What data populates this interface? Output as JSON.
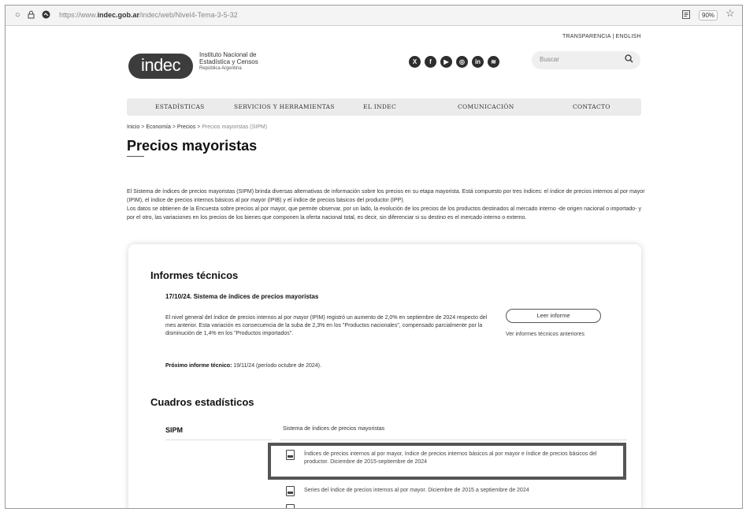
{
  "browser": {
    "url_prefix": "https://www.",
    "url_domain": "indec.gob.ar",
    "url_path": "/indec/web/Nivel4-Tema-3-5-32",
    "zoom": "90%"
  },
  "header": {
    "top_links": "TRANSPARENCIA | ENGLISH",
    "logo_text": "indec",
    "org_line1": "Instituto Nacional de",
    "org_line2": "Estadística y Censos",
    "org_line3": "República Argentina",
    "social_icons": [
      "x-icon",
      "facebook-icon",
      "youtube-icon",
      "instagram-icon",
      "linkedin-icon",
      "spotify-icon"
    ],
    "search_placeholder": "Buscar"
  },
  "nav": {
    "items": [
      "ESTADÍSTICAS",
      "SERVICIOS Y HERRAMIENTAS",
      "EL INDEC",
      "COMUNICACIÓN",
      "CONTACTO"
    ]
  },
  "breadcrumb": {
    "items": [
      "Inicio",
      "Economía",
      "Precios",
      "Precios mayoristas (SIPM)"
    ],
    "separator": ">"
  },
  "page": {
    "title": "Precios mayoristas",
    "intro_p1": "El Sistema de índices de precios mayoristas (SIPM) brinda diversas alternativas de información sobre los precios en su etapa mayorista. Está compuesto por tres índices: el índice de precios internos al por mayor (IPIM), el índice de precios internos básicos al por mayor (IPIB) y el índice de precios básicos del productor (IPP).",
    "intro_p2": "Los datos se obtienen de la Encuesta sobre precios al por mayor, que permite observar, por un lado, la evolución de los precios de los productos destinados al mercado interno -de origen nacional o importado- y por el otro, las variaciones en los precios de los bienes que componen la oferta nacional total, es decir, sin diferenciar si su destino es el mercado interno o externo."
  },
  "informes": {
    "heading": "Informes técnicos",
    "report_title": "17/10/24. Sistema de índices de precios mayoristas",
    "report_text": "El nivel general del índice de precios internos al por mayor (IPIM) registró un aumento de 2,0% en septiembre de 2024 respecto del mes anterior. Esta variación es consecuencia de la suba de 2,3% en los \"Productos nacionales\", compensado parcialmente por la disminución de 1,4% en los \"Productos importados\".",
    "next_label": "Próximo informe técnico:",
    "next_value": "19/11/24 (período octubre de 2024).",
    "read_button": "Leer informe",
    "previous_link": "Ver informes técnicos anteriores"
  },
  "cuadros": {
    "heading": "Cuadros estadísticos",
    "sipm_label": "SIPM",
    "sipm_desc": "Sistema de índices de precios mayoristas",
    "files": [
      "Índices de precios internos al por mayor, índice de precios internos básicos al por mayor e índice de precios básicos del productor. Diciembre de 2015-septiembre de 2024",
      "Series del índice de precios internos al por mayor. Diciembre de 2015 a septiembre de 2024"
    ]
  }
}
